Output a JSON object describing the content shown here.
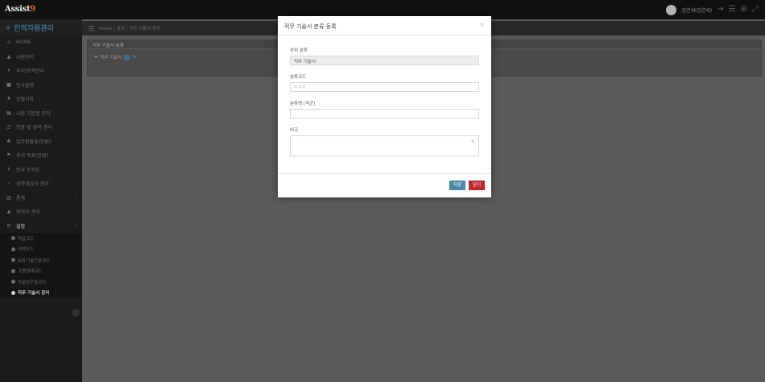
{
  "app": {
    "logo_main": "Assist",
    "logo_accent": "9",
    "title": "인적자원관리",
    "user_name": "김연세(김연세)"
  },
  "breadcrumb": "Home / 설정 / 직무 기술서 관리",
  "sidebar": {
    "items": [
      {
        "label": "HOME",
        "icon": "home-icon",
        "glyph": "⌂"
      },
      {
        "label": "사원관리",
        "icon": "person-icon",
        "glyph": "▲"
      },
      {
        "label": "부서/조직관리",
        "icon": "org-icon",
        "glyph": "⚘"
      },
      {
        "label": "인사발령",
        "icon": "doc-icon",
        "glyph": "■"
      },
      {
        "label": "상벌사항",
        "icon": "award-icon",
        "glyph": "♦"
      },
      {
        "label": "사원 기본정 관리",
        "icon": "calendar-icon",
        "glyph": "▦"
      },
      {
        "label": "연봉 및 경력 관리",
        "icon": "chart-icon",
        "glyph": "◫"
      },
      {
        "label": "업무현황표(인원)",
        "icon": "people-icon",
        "glyph": "♣"
      },
      {
        "label": "부서 목표(인원)",
        "icon": "flag-icon",
        "glyph": "⚑"
      },
      {
        "label": "인사 조직도",
        "icon": "tree-icon",
        "glyph": "⚘"
      },
      {
        "label": "성한대상자 관리",
        "icon": "thumb-icon",
        "glyph": "✓"
      },
      {
        "label": "통계",
        "icon": "stats-icon",
        "glyph": "▥",
        "caret": "‹"
      },
      {
        "label": "퇴직자 관리",
        "icon": "user-out-icon",
        "glyph": "▲"
      }
    ],
    "setting_label": "설정",
    "setting_glyph": "⚙",
    "setting_caret": "‹",
    "sub_items": [
      {
        "label": "직급코드",
        "active": false
      },
      {
        "label": "직책코드",
        "active": false
      },
      {
        "label": "보유기술구분코드",
        "active": false
      },
      {
        "label": "고용형태코드",
        "active": false
      },
      {
        "label": "가분임구분코드",
        "active": false
      },
      {
        "label": "직무 기술서 관리",
        "active": true
      }
    ]
  },
  "panel": {
    "title": "직무 기술서 분류",
    "tree_label": "직무 기술서"
  },
  "modal": {
    "title": "직무 기술서 분류 등록",
    "close_glyph": "×",
    "parent_label": "상위 분류",
    "parent_value": "직무 기술서",
    "code_label": "분류코드",
    "code_placeholder": "X.0.0",
    "name_label": "분류명 (직군)",
    "name_value": "",
    "note_label": "비고",
    "note_value": "",
    "save_label": "저장",
    "close_label": "닫기"
  }
}
